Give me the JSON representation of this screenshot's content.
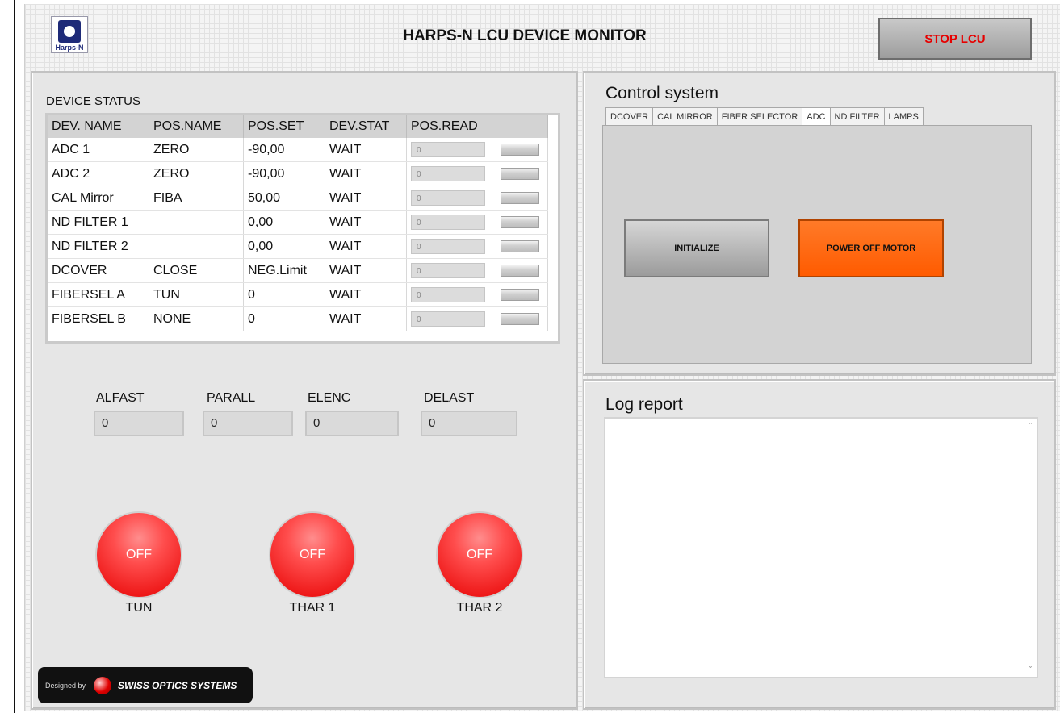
{
  "header": {
    "logo_text": "Harps-N",
    "title": "HARPS-N LCU DEVICE MONITOR",
    "stop_label": "STOP LCU"
  },
  "device_status": {
    "label": "DEVICE STATUS",
    "columns": [
      "DEV. NAME",
      "POS.NAME",
      "POS.SET",
      "DEV.STAT",
      "POS.READ"
    ],
    "rows": [
      {
        "name": "ADC 1",
        "pos_name": "ZERO",
        "pos_set": "-90,00",
        "stat": "WAIT",
        "pos_read": "0"
      },
      {
        "name": "ADC 2",
        "pos_name": "ZERO",
        "pos_set": "-90,00",
        "stat": "WAIT",
        "pos_read": "0"
      },
      {
        "name": "CAL Mirror",
        "pos_name": "FIBA",
        "pos_set": "50,00",
        "stat": "WAIT",
        "pos_read": "0"
      },
      {
        "name": "ND FILTER 1",
        "pos_name": "",
        "pos_set": "0,00",
        "stat": "WAIT",
        "pos_read": "0"
      },
      {
        "name": "ND FILTER 2",
        "pos_name": "",
        "pos_set": "0,00",
        "stat": "WAIT",
        "pos_read": "0"
      },
      {
        "name": "DCOVER",
        "pos_name": "CLOSE",
        "pos_set": "NEG.Limit",
        "stat": "WAIT",
        "pos_read": "0"
      },
      {
        "name": "FIBERSEL A",
        "pos_name": "TUN",
        "pos_set": "0",
        "stat": "WAIT",
        "pos_read": "0"
      },
      {
        "name": "FIBERSEL B",
        "pos_name": "NONE",
        "pos_set": "0",
        "stat": "WAIT",
        "pos_read": "0"
      }
    ]
  },
  "indicators": {
    "alfast": {
      "label": "ALFAST",
      "value": "0"
    },
    "parall": {
      "label": "PARALL",
      "value": "0"
    },
    "elenc": {
      "label": "ELENC",
      "value": "0"
    },
    "delast": {
      "label": "DELAST",
      "value": "0"
    }
  },
  "lamps": [
    {
      "state": "OFF",
      "label": "TUN"
    },
    {
      "state": "OFF",
      "label": "THAR 1"
    },
    {
      "state": "OFF",
      "label": "THAR 2"
    }
  ],
  "badge": {
    "designed_by": "Designed by",
    "company": "SWISS OPTICS SYSTEMS"
  },
  "control": {
    "title": "Control system",
    "tabs": [
      "DCOVER",
      "CAL MIRROR",
      "FIBER SELECTOR",
      "ADC",
      "ND FILTER",
      "LAMPS"
    ],
    "active_tab": "ADC",
    "initialize_label": "INITIALIZE",
    "power_off_label": "POWER OFF MOTOR"
  },
  "log": {
    "title": "Log report",
    "content": ""
  },
  "colors": {
    "stop_text": "#e60000",
    "power_button": "#ff5b00",
    "lamp_off": "#ff3b3b"
  }
}
